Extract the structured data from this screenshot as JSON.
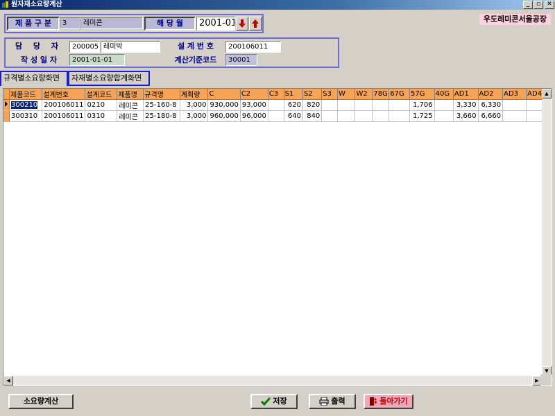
{
  "window": {
    "title": "원자재소요량계산"
  },
  "brand": "우도레미콘서울공장",
  "header": {
    "product_type_label": "제 품 구 분",
    "product_type_code": "3",
    "product_type_name": "레미콘",
    "month_label": "해 당 월",
    "month_value": "2001-01"
  },
  "info": {
    "manager_label": "담 당 자",
    "manager_code": "200005",
    "manager_name": "레미박",
    "design_no_label": "설 계 번 호",
    "design_no_value": "200106011",
    "date_label": "작 성 일 자",
    "date_value": "2001-01-01",
    "calc_code_label": "계산기준코드",
    "calc_code_value": "30001"
  },
  "tabs": [
    {
      "label": "규격별소요량화면"
    },
    {
      "label": "자재별소요량합계화면"
    }
  ],
  "grid": {
    "columns": [
      "제품코드",
      "설계번호",
      "설계코드",
      "제품명",
      "규격명",
      "계획량",
      "C",
      "C2",
      "C3",
      "S1",
      "S2",
      "S3",
      "W",
      "W2",
      "78G",
      "67G",
      "57G",
      "40G",
      "AD1",
      "AD2",
      "AD3",
      "AD4"
    ],
    "rows": [
      [
        "300210",
        "200106011",
        "0210",
        "레미콘",
        "25-160-8",
        "3,000",
        "930,000",
        "93,000",
        "",
        "620",
        "820",
        "",
        "",
        "",
        "",
        "",
        "1,706",
        "",
        "3,330",
        "6,330",
        "",
        ""
      ],
      [
        "300310",
        "200106011",
        "0310",
        "레미콘",
        "25-180-8",
        "3,000",
        "960,000",
        "96,000",
        "",
        "640",
        "840",
        "",
        "",
        "",
        "",
        "",
        "1,725",
        "",
        "3,660",
        "6,660",
        "",
        ""
      ]
    ]
  },
  "buttons": {
    "calc": "소요량계산",
    "save": "저장",
    "print": "출력",
    "back": "돌아가기"
  },
  "colors": {
    "title_bar": "#0a246a",
    "grid_header": "#f5a356",
    "group_border": "#6b6bd0",
    "brand_bg": "#ffd0e0",
    "label_bg": "#b9b9d6"
  }
}
